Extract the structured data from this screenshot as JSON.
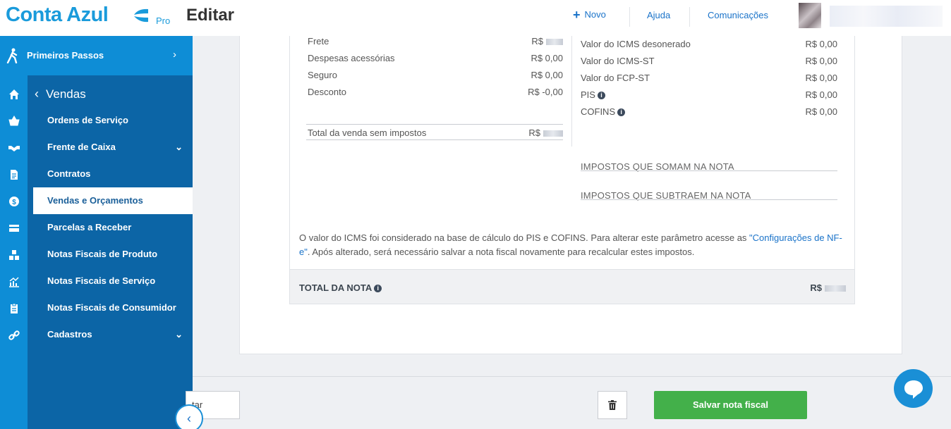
{
  "header": {
    "logo_text": "Conta Azul",
    "logo_badge": "Pro",
    "page_title": "Editar",
    "nav": {
      "novo": "Novo",
      "ajuda": "Ajuda",
      "comunicacoes": "Comunicações"
    }
  },
  "sidebar": {
    "primeiros_passos": "Primeiros Passos",
    "section_title": "Vendas",
    "items": [
      {
        "label": "Ordens de Serviço",
        "active": false,
        "expandable": false
      },
      {
        "label": "Frente de Caixa",
        "active": false,
        "expandable": true
      },
      {
        "label": "Contratos",
        "active": false,
        "expandable": false
      },
      {
        "label": "Vendas e Orçamentos",
        "active": true,
        "expandable": false
      },
      {
        "label": "Parcelas a Receber",
        "active": false,
        "expandable": false
      },
      {
        "label": "Notas Fiscais de Produto",
        "active": false,
        "expandable": false
      },
      {
        "label": "Notas Fiscais de Serviço",
        "active": false,
        "expandable": false
      },
      {
        "label": "Notas Fiscais de Consumidor",
        "active": false,
        "expandable": false
      },
      {
        "label": "Cadastros",
        "active": false,
        "expandable": true
      }
    ],
    "rail_icons": [
      "home-icon",
      "basket-icon",
      "handshake-icon",
      "document-icon",
      "dollar-icon",
      "card-icon",
      "boxes-icon",
      "chart-icon",
      "clipboard-icon",
      "link-icon"
    ]
  },
  "left_totals": {
    "frete": {
      "label": "Frete",
      "value": "R$"
    },
    "despesas": {
      "label": "Despesas acessórias",
      "value": "R$ 0,00"
    },
    "seguro": {
      "label": "Seguro",
      "value": "R$ 0,00"
    },
    "desconto": {
      "label": "Desconto",
      "value": "R$ -0,00"
    },
    "total_sem_impostos": {
      "label": "Total da venda sem impostos",
      "value": "R$"
    }
  },
  "right_taxes": {
    "icms_desonerado": {
      "label": "Valor do ICMS desonerado",
      "value": "R$ 0,00"
    },
    "icms_st": {
      "label": "Valor do ICMS-ST",
      "value": "R$ 0,00"
    },
    "fcp_st": {
      "label": "Valor do FCP-ST",
      "value": "R$ 0,00"
    },
    "pis": {
      "label": "PIS",
      "value": "R$ 0,00"
    },
    "cofins": {
      "label": "COFINS",
      "value": "R$ 0,00"
    },
    "somam_title": "IMPOSTOS QUE SOMAM NA NOTA",
    "subtraem_title": "IMPOSTOS QUE SUBTRAEM NA NOTA"
  },
  "note": {
    "text_before": "O valor do ICMS foi considerado na base de cálculo do PIS e COFINS. Para alterar este parâmetro acesse as ",
    "link": "\"Configurações de NF-e\"",
    "text_after": ". Após alterado, será necessário salvar a nota fiscal novamente para recalcular estes impostos."
  },
  "total": {
    "label": "TOTAL DA NOTA",
    "currency": "R$"
  },
  "footer": {
    "cancel_label": "tar",
    "save_label": "Salvar nota fiscal"
  },
  "colors": {
    "brand": "#1a9bdb",
    "sidebar_dark": "#0c65a6",
    "sidebar_light": "#0e8dd6",
    "save": "#43b04a",
    "link": "#1a73c9"
  }
}
